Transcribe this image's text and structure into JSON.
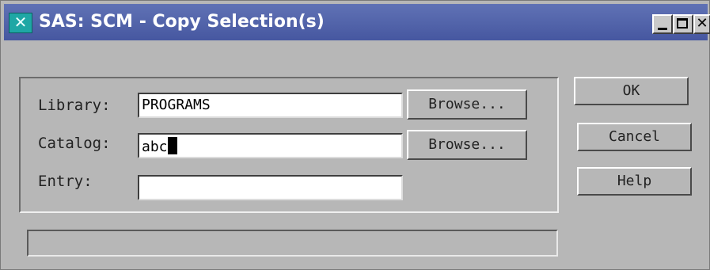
{
  "window": {
    "title": "SAS: SCM - Copy Selection(s)",
    "icon": "sas-app-icon",
    "controls": [
      "minimize-icon",
      "maximize-icon",
      "close-icon"
    ]
  },
  "form": {
    "library": {
      "label": "Library:",
      "value": "PROGRAMS",
      "browse_label": "Browse..."
    },
    "catalog": {
      "label": "Catalog:",
      "value": "abc",
      "browse_label": "Browse..."
    },
    "entry": {
      "label": "Entry:",
      "value": ""
    }
  },
  "actions": {
    "ok_label": "OK",
    "cancel_label": "Cancel",
    "help_label": "Help"
  },
  "status": {
    "text": ""
  },
  "colors": {
    "titlebar": "#4d5fa5",
    "window_bg": "#b7b7b7",
    "field_bg": "#ffffff"
  }
}
